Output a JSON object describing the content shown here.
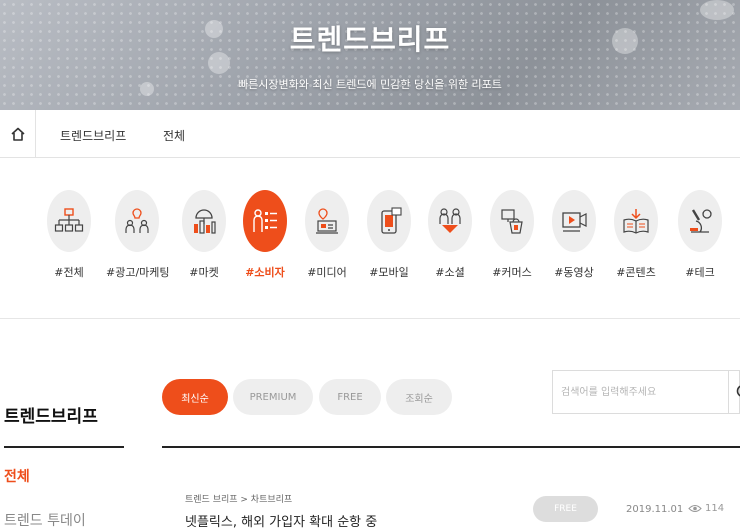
{
  "hero": {
    "title": "트렌드브리프",
    "subtitle": "빠른시장변화와 최신 트렌드에 민감한 당신을 위한 리포트"
  },
  "breadcrumb": {
    "items": [
      "트렌드브리프",
      "전체"
    ]
  },
  "categories": [
    {
      "label": "#전체",
      "icon": "org-chart-icon"
    },
    {
      "label": "#광고/마케팅",
      "icon": "marketing-people-icon"
    },
    {
      "label": "#마켓",
      "icon": "market-umbrella-icon"
    },
    {
      "label": "#소비자",
      "icon": "consumer-icon",
      "active": true
    },
    {
      "label": "#미디어",
      "icon": "media-icon"
    },
    {
      "label": "#모바일",
      "icon": "mobile-icon"
    },
    {
      "label": "#소셜",
      "icon": "social-icon"
    },
    {
      "label": "#커머스",
      "icon": "commerce-icon"
    },
    {
      "label": "#동영상",
      "icon": "video-icon"
    },
    {
      "label": "#콘텐츠",
      "icon": "content-book-icon"
    },
    {
      "label": "#테크",
      "icon": "tech-microscope-icon"
    }
  ],
  "sidebar": {
    "title": "트렌드브리프",
    "items": [
      "전체",
      "트렌드 투데이"
    ]
  },
  "tabs": [
    "최신순",
    "PREMIUM",
    "FREE",
    "조회순"
  ],
  "search": {
    "placeholder": "검색어를 입력해주세요"
  },
  "articles": [
    {
      "category": "트렌드 브리프 > 차트브리프",
      "title": "넷플릭스, 해외 가입자 확대 순항 중",
      "badge": "FREE",
      "date": "2019.11.01",
      "views": "114"
    }
  ],
  "colors": {
    "accent": "#ee4e1b",
    "tab_bg": "#eeeeee",
    "icon_circle": "#eeeeee"
  }
}
